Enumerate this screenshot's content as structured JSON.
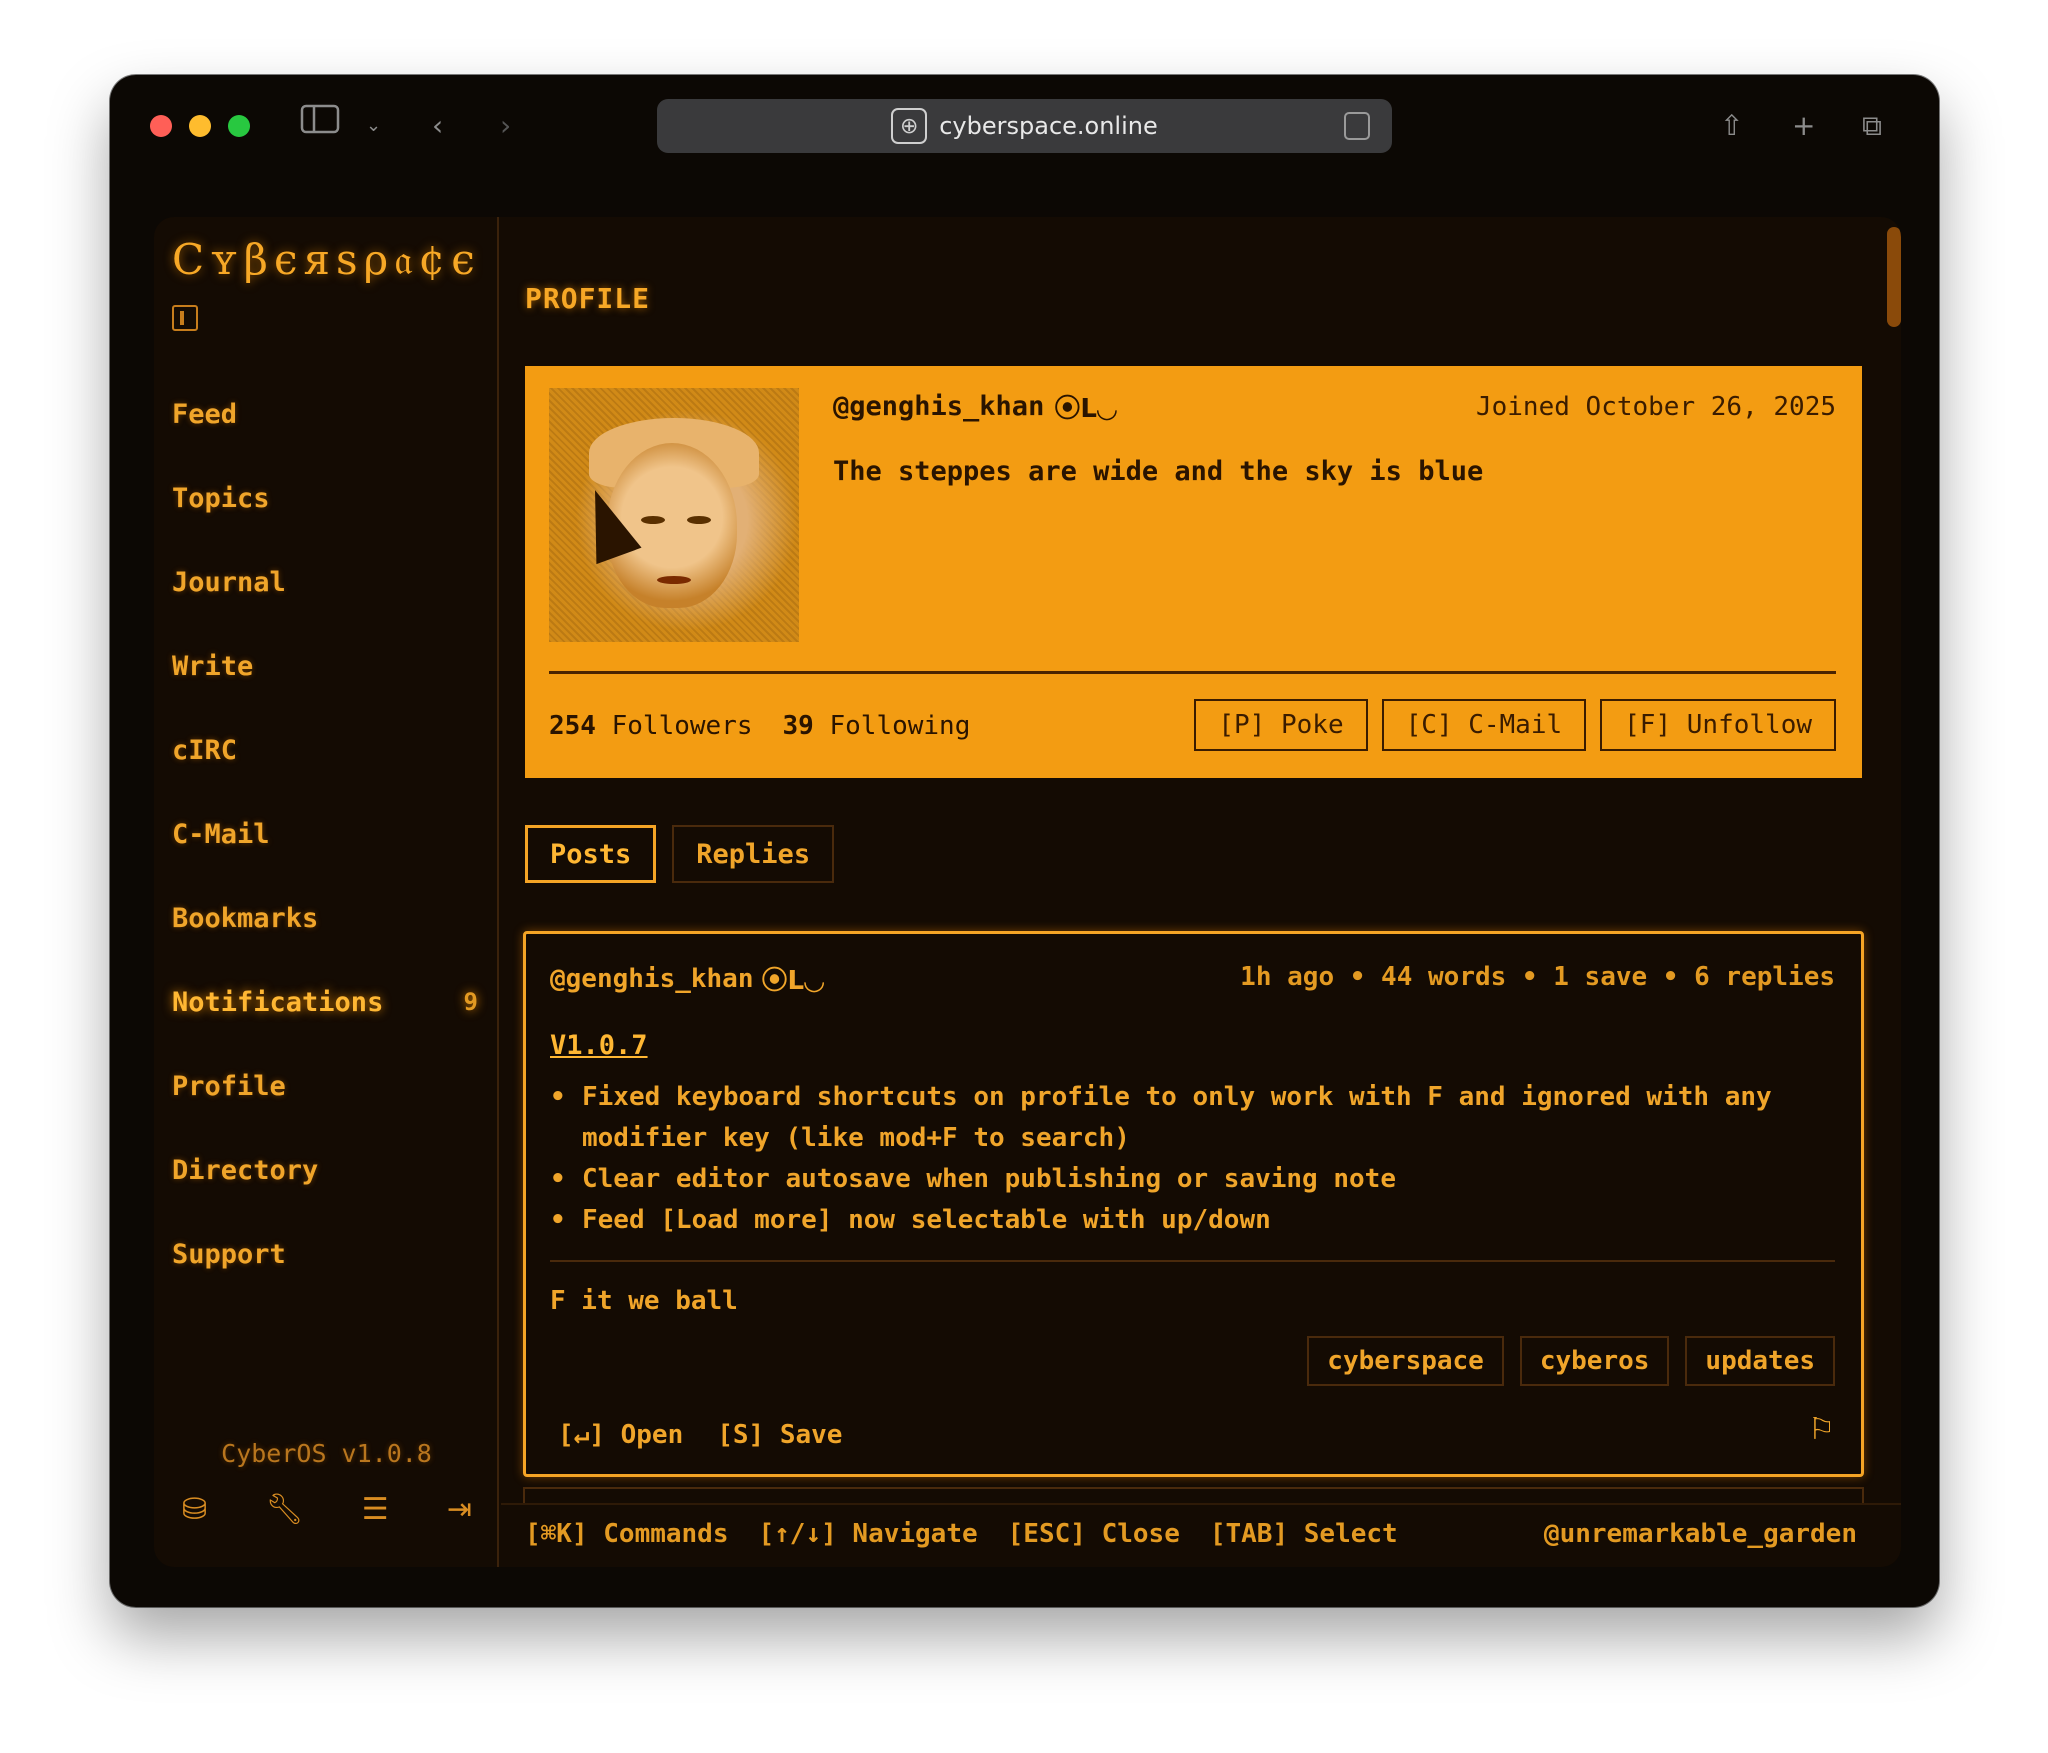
{
  "browser": {
    "url": "cyberspace.online",
    "toolbar_icons": [
      "sidebar-icon",
      "chevron-down-icon",
      "back-icon",
      "forward-icon",
      "share-icon",
      "new-tab-icon",
      "tabs-overview-icon"
    ]
  },
  "app": {
    "logo": "Cʏβєяѕρ𝔞¢є",
    "version": "CyberOS v1.0.8"
  },
  "sidebar": {
    "items": [
      {
        "label": "Feed"
      },
      {
        "label": "Topics"
      },
      {
        "label": "Journal"
      },
      {
        "label": "Write"
      },
      {
        "label": "cIRC"
      },
      {
        "label": "C-Mail"
      },
      {
        "label": "Bookmarks"
      },
      {
        "label": "Notifications",
        "badge": "9",
        "active": true
      },
      {
        "label": "Profile"
      },
      {
        "label": "Directory"
      },
      {
        "label": "Support"
      }
    ],
    "bottom_icons": [
      "database-icon",
      "wrench-icon",
      "menu-icon",
      "logout-icon"
    ]
  },
  "page": {
    "heading": "PROFILE"
  },
  "profile": {
    "handle": "@genghis_khan",
    "badges": "⦿L◡",
    "joined": "Joined October 26, 2025",
    "bio": "The steppes are wide and the sky is blue",
    "followers": "254",
    "followers_label": "Followers",
    "following": "39",
    "following_label": "Following",
    "actions": {
      "poke": "[P] Poke",
      "cmail": "[C] C-Mail",
      "unfollow": "[F] Unfollow"
    }
  },
  "tabs": {
    "posts": "Posts",
    "replies": "Replies",
    "active": "Posts"
  },
  "post": {
    "author": "@genghis_khan",
    "badges": "⦿L◡",
    "meta": "1h ago • 44 words • 1 save • 6 replies",
    "title": "V1.0.7",
    "bullets": [
      "Fixed keyboard shortcuts on profile to only work with F and ignored with any modifier key (like mod+F to search)",
      "Clear editor autosave when publishing or saving note",
      "Feed [Load more] now selectable with up/down"
    ],
    "body": "F it we ball",
    "tags": [
      "cyberspace",
      "cyberos",
      "updates"
    ],
    "open_label": "[↵] Open",
    "save_label": "[S] Save"
  },
  "statusbar": {
    "commands": "[⌘K] Commands",
    "navigate": "[↑/↓] Navigate",
    "close": "[ESC] Close",
    "select": "[TAB] Select",
    "user": "@unremarkable_garden"
  },
  "colors": {
    "accent": "#f39c12",
    "text_amber": "#f0a52a",
    "background": "#140b03"
  }
}
